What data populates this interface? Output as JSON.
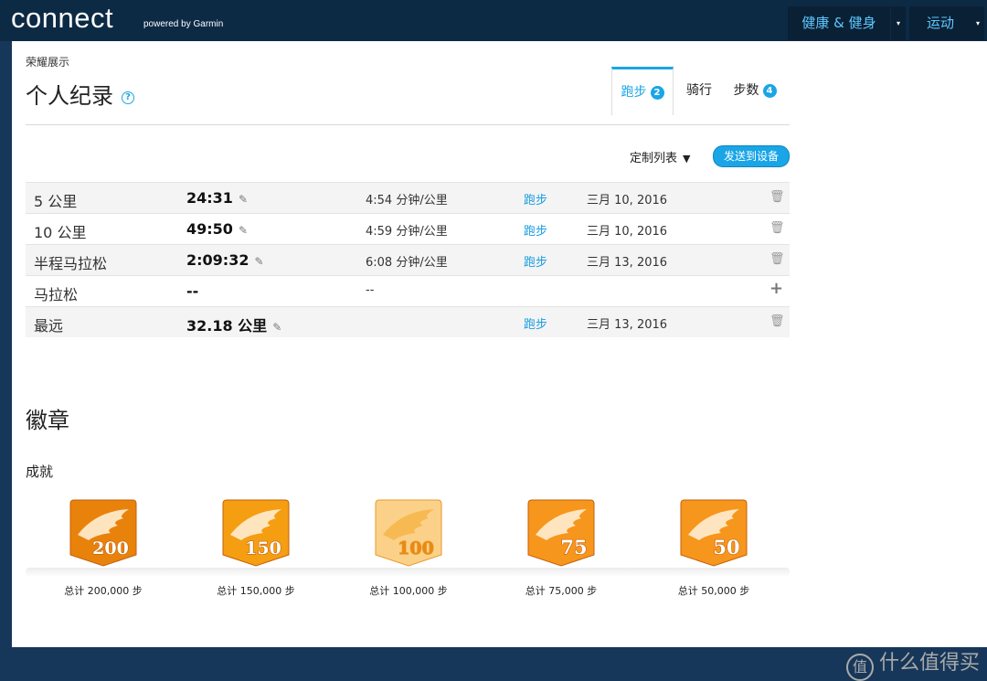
{
  "header": {
    "logo": "connect",
    "logo_sub": "powered by Garmin",
    "nav": [
      {
        "label": "健康 & 健身"
      },
      {
        "label": "运动"
      }
    ]
  },
  "breadcrumb": "荣耀展示",
  "page_title": "个人纪录",
  "tabs": [
    {
      "label": "跑步",
      "badge": "2",
      "active": true
    },
    {
      "label": "骑行",
      "badge": ""
    },
    {
      "label": "步数",
      "badge": "4"
    }
  ],
  "toolbar": {
    "customize_label": "定制列表",
    "send_label": "发送到设备"
  },
  "records": [
    {
      "name": "5 公里",
      "time": "24:31",
      "pace": "4:54 分钟/公里",
      "type": "跑步",
      "date": "三月 10, 2016",
      "action": "delete"
    },
    {
      "name": "10 公里",
      "time": "49:50",
      "pace": "4:59 分钟/公里",
      "type": "跑步",
      "date": "三月 10, 2016",
      "action": "delete"
    },
    {
      "name": "半程马拉松",
      "time": "2:09:32",
      "pace": "6:08 分钟/公里",
      "type": "跑步",
      "date": "三月 13, 2016",
      "action": "delete"
    },
    {
      "name": "马拉松",
      "time": "--",
      "pace": "--",
      "type": "",
      "date": "",
      "action": "add"
    },
    {
      "name": "最远",
      "time": "32.18 公里",
      "pace": "",
      "type": "跑步",
      "date": "三月 13, 2016",
      "action": "delete"
    }
  ],
  "badges_section": {
    "title": "徽章",
    "subtitle": "成就",
    "items": [
      {
        "number": "200",
        "label": "总计 200,000 步",
        "color": "#e9820b",
        "icon": "wing-badge-icon"
      },
      {
        "number": "150",
        "label": "总计 150,000 步",
        "color": "#f59e12",
        "icon": "wing-badge-icon"
      },
      {
        "number": "100",
        "label": "总计 100,000 步",
        "color": "#fbd18a",
        "icon": "wing-badge-icon"
      },
      {
        "number": "75",
        "label": "总计 75,000 步",
        "color": "#f7961c",
        "icon": "wing-badge-icon"
      },
      {
        "number": "50",
        "label": "总计 50,000 步",
        "color": "#f7961c",
        "icon": "wing-badge-icon"
      }
    ]
  },
  "watermark": "什么值得买",
  "colors": {
    "accent": "#1aa5e6",
    "header": "#0d2a45"
  }
}
